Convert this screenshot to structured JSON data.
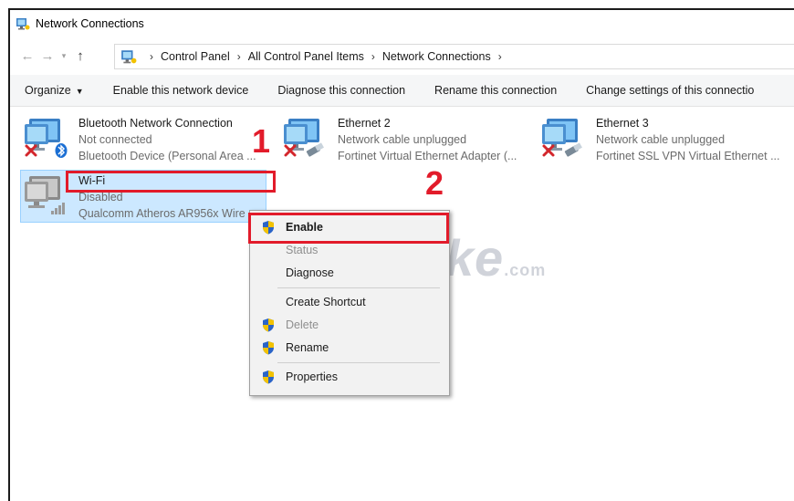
{
  "window": {
    "title": "Network Connections"
  },
  "address": {
    "breadcrumbs": [
      "Control Panel",
      "All Control Panel Items",
      "Network Connections"
    ]
  },
  "toolbar": {
    "organize": "Organize",
    "enable": "Enable this network device",
    "diagnose": "Diagnose this connection",
    "rename": "Rename this connection",
    "change": "Change settings of this connectio"
  },
  "connections": [
    {
      "name": "Bluetooth Network Connection",
      "status": "Not connected",
      "device": "Bluetooth Device (Personal Area ...",
      "icon": "bluetooth-network-icon"
    },
    {
      "name": "Ethernet 2",
      "status": "Network cable unplugged",
      "device": "Fortinet Virtual Ethernet Adapter (...",
      "icon": "ethernet-icon"
    },
    {
      "name": "Ethernet 3",
      "status": "Network cable unplugged",
      "device": "Fortinet SSL VPN Virtual Ethernet ...",
      "icon": "ethernet-icon"
    },
    {
      "name": "Wi-Fi",
      "status": "Disabled",
      "device": "Qualcomm Atheros AR956x Wire",
      "icon": "wifi-icon"
    }
  ],
  "annotations": {
    "step1": "1",
    "step2": "2"
  },
  "context_menu": {
    "enable": "Enable",
    "status": "Status",
    "diagnose": "Diagnose",
    "create_shortcut": "Create Shortcut",
    "delete": "Delete",
    "rename": "Rename",
    "properties": "Properties"
  },
  "watermark": {
    "main": "TipsMake",
    "suffix": ".com"
  },
  "colors": {
    "selection": "#cce8ff",
    "highlight_box": "#e21b2a",
    "menu_bg": "#f2f2f2"
  }
}
